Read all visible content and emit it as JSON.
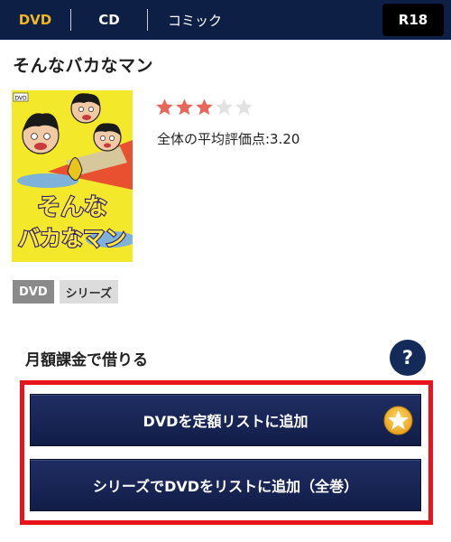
{
  "nav": {
    "tabs": [
      {
        "label": "DVD",
        "active": true
      },
      {
        "label": "CD",
        "active": false
      },
      {
        "label": "コミック",
        "active": false
      }
    ],
    "r18_label": "R18",
    "active_color": "#f0b623",
    "bar_color": "#0e1f45"
  },
  "product": {
    "title": "そんなバカなマン",
    "rating": {
      "filled": 3,
      "max": 5
    },
    "average_label": "全体の平均評価点:3.20",
    "cover": {
      "dvd_mark": "DVD",
      "title_line1": "そんな",
      "title_line2": "バカなマン"
    },
    "tags": [
      "DVD",
      "シリーズ"
    ]
  },
  "rental": {
    "section_label": "月額課金で借りる",
    "help_label": "?",
    "add_button_label": "DVDを定額リストに追加",
    "add_series_button_label": "シリーズでDVDをリストに追加（全巻）",
    "highlight_color": "#e8141c"
  }
}
